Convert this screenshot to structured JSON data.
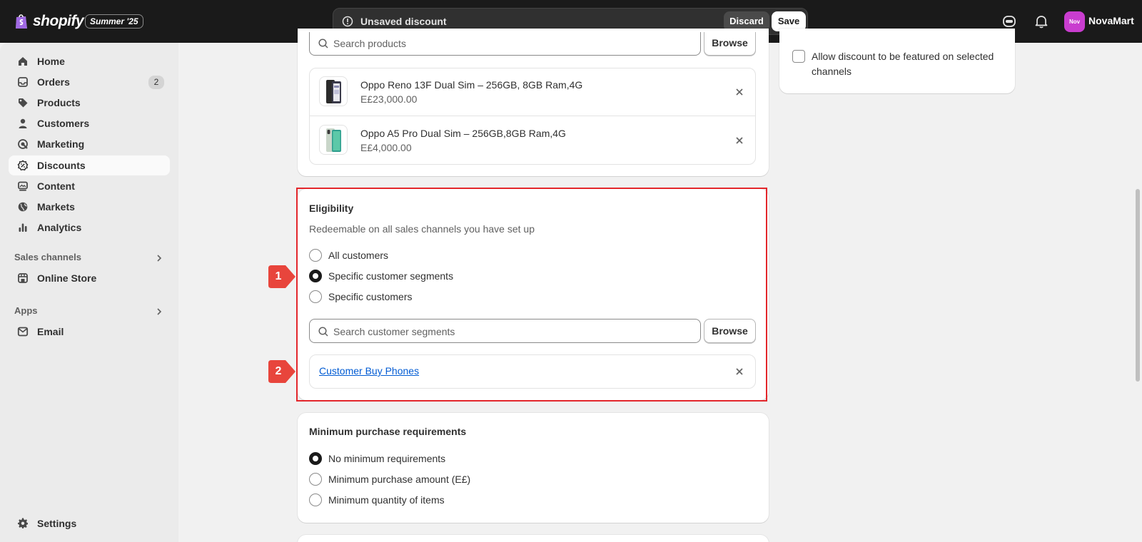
{
  "topbar": {
    "logo_text": "shopify",
    "edition": "Summer '25",
    "save_bar_message": "Unsaved discount",
    "discard_label": "Discard",
    "save_label": "Save",
    "avatar_initials": "Nov",
    "store_name": "NovaMart"
  },
  "sidebar": {
    "items": [
      {
        "label": "Home",
        "icon": "home-icon"
      },
      {
        "label": "Orders",
        "icon": "orders-icon",
        "badge": "2"
      },
      {
        "label": "Products",
        "icon": "tag-icon"
      },
      {
        "label": "Customers",
        "icon": "person-icon"
      },
      {
        "label": "Marketing",
        "icon": "target-icon"
      },
      {
        "label": "Discounts",
        "icon": "discount-icon",
        "active": true
      },
      {
        "label": "Content",
        "icon": "image-icon"
      },
      {
        "label": "Markets",
        "icon": "globe-icon"
      },
      {
        "label": "Analytics",
        "icon": "bar-chart-icon"
      }
    ],
    "sales_channels_heading": "Sales channels",
    "online_store_label": "Online Store",
    "apps_heading": "Apps",
    "email_label": "Email",
    "settings_label": "Settings"
  },
  "products_card": {
    "search_placeholder": "Search products",
    "browse_label": "Browse",
    "products": [
      {
        "title": "Oppo Reno 13F Dual Sim – 256GB, 8GB Ram,4G",
        "price": "E£23,000.00"
      },
      {
        "title": "Oppo A5 Pro Dual Sim – 256GB,8GB Ram,4G",
        "price": "E£4,000.00"
      }
    ]
  },
  "eligibility": {
    "title": "Eligibility",
    "subtitle": "Redeemable on all sales channels you have set up",
    "options": [
      "All customers",
      "Specific customer segments",
      "Specific customers"
    ],
    "selected": "Specific customer segments",
    "search_placeholder": "Search customer segments",
    "browse_label": "Browse",
    "segment_link": "Customer Buy Phones"
  },
  "minimum_purchase": {
    "title": "Minimum purchase requirements",
    "options": [
      "No minimum requirements",
      "Minimum purchase amount (E£)",
      "Minimum quantity of items"
    ],
    "selected": "No minimum requirements"
  },
  "right_panel": {
    "featured_checkbox_label": "Allow discount to be featured on selected channels"
  },
  "annotations": {
    "marker_1": "1",
    "marker_2": "2"
  },
  "colors": {
    "topbar_bg": "#1a1a1a",
    "highlight_border": "#e3262b",
    "marker_fill": "#e8453c",
    "link": "#005bd3",
    "avatar_bg": "#c93dcf"
  }
}
